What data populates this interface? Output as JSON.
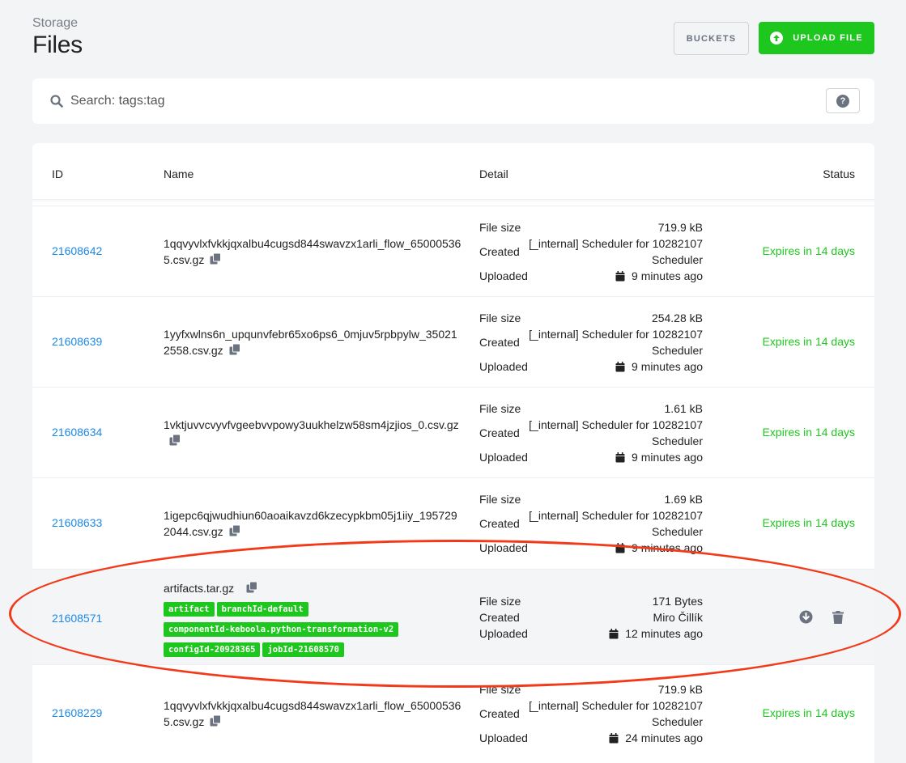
{
  "header": {
    "breadcrumb": "Storage",
    "title": "Files",
    "buckets_label": "BUCKETS",
    "upload_label": "UPLOAD FILE"
  },
  "search": {
    "placeholder": "Search: tags:tag",
    "help_label": "?"
  },
  "table": {
    "columns": {
      "id": "ID",
      "name": "Name",
      "detail": "Detail",
      "status": "Status"
    },
    "labels": {
      "file_size": "File size",
      "created": "Created",
      "uploaded": "Uploaded"
    },
    "rows": [
      {
        "id": "21608642",
        "name": "1qqvyvlxfvkkjqxalbu4cugsd844swavzx1arli_flow_650005365.csv.gz",
        "file_size": "719.9 kB",
        "created": "[_internal] Scheduler for 10282107 Scheduler",
        "uploaded": "9 minutes ago",
        "status": "Expires in 14 days"
      },
      {
        "id": "21608639",
        "name": "1yyfxwlns6n_upqunvfebr65xo6ps6_0mjuv5rpbpylw_350212558.csv.gz",
        "file_size": "254.28 kB",
        "created": "[_internal] Scheduler for 10282107 Scheduler",
        "uploaded": "9 minutes ago",
        "status": "Expires in 14 days"
      },
      {
        "id": "21608634",
        "name": "1vktjuvvcvyvfvgeebvvpowy3uukhelzw58sm4jzjios_0.csv.gz",
        "file_size": "1.61 kB",
        "created": "[_internal] Scheduler for 10282107 Scheduler",
        "uploaded": "9 minutes ago",
        "status": "Expires in 14 days"
      },
      {
        "id": "21608633",
        "name": "1igepc6qjwudhiun60aoaikavzd6kzecypkbm05j1iiy_1957292044.csv.gz",
        "file_size": "1.69 kB",
        "created": "[_internal] Scheduler for 10282107 Scheduler",
        "uploaded": "9 minutes ago",
        "status": "Expires in 14 days"
      },
      {
        "id": "21608571",
        "name": "artifacts.tar.gz",
        "tags": [
          "artifact",
          "branchId-default",
          "componentId-keboola.python-transformation-v2",
          "configId-20928365",
          "jobId-21608570"
        ],
        "file_size": "171 Bytes",
        "created": "Miro Čillík",
        "uploaded": "12 minutes ago",
        "status": ""
      },
      {
        "id": "21608229",
        "name": "1qqvyvlxfvkkjqxalbu4cugsd844swavzx1arli_flow_650005365.csv.gz",
        "file_size": "719.9 kB",
        "created": "[_internal] Scheduler for 10282107 Scheduler",
        "uploaded": "24 minutes ago",
        "status": "Expires in 14 days"
      }
    ]
  },
  "icons": {
    "search": "search-icon",
    "copy": "copy-icon",
    "calendar": "calendar-icon",
    "download": "download-icon",
    "delete": "trash-icon",
    "upload": "upload-icon",
    "help": "help-icon"
  },
  "colors": {
    "accent_green": "#1ec71e",
    "link_blue": "#1e88e5",
    "annotation_red": "#f23a1a"
  }
}
